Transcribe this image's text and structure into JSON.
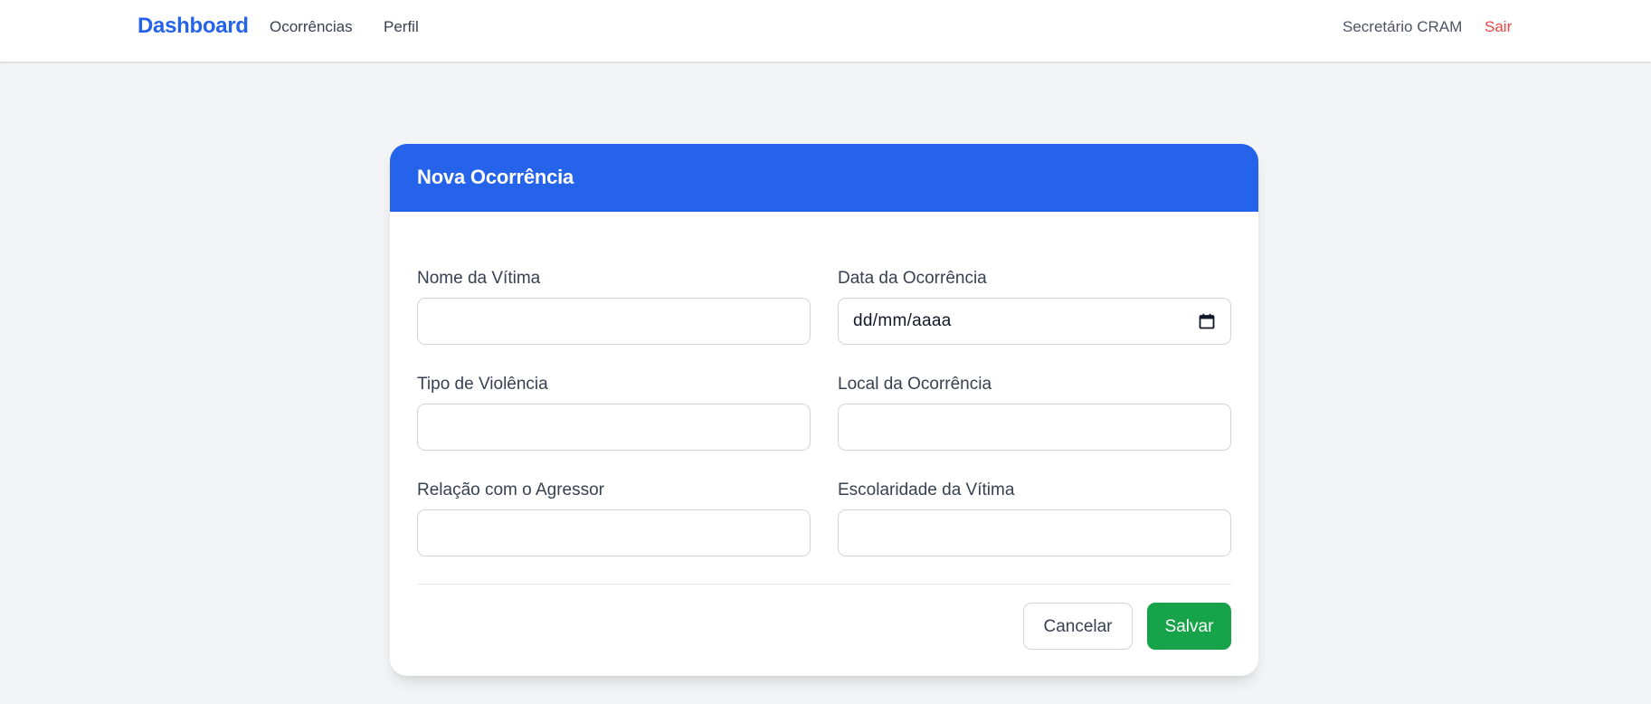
{
  "navbar": {
    "brand": "Dashboard",
    "links": [
      "Ocorrências",
      "Perfil"
    ],
    "user_name": "Secretário CRAM",
    "logout_label": "Sair"
  },
  "form": {
    "title": "Nova Ocorrência",
    "fields": {
      "nome_vitima": {
        "label": "Nome da Vítima",
        "value": ""
      },
      "data_ocorrencia": {
        "label": "Data da Ocorrência",
        "placeholder": "dd/mm/aaaa",
        "value": ""
      },
      "tipo_violencia": {
        "label": "Tipo de Violência",
        "value": ""
      },
      "local_ocorrencia": {
        "label": "Local da Ocorrência",
        "value": ""
      },
      "relacao_agressor": {
        "label": "Relação com o Agressor",
        "value": ""
      },
      "escolaridade_vitima": {
        "label": "Escolaridade da Vítima",
        "value": ""
      }
    },
    "actions": {
      "cancel_label": "Cancelar",
      "save_label": "Salvar"
    }
  },
  "icons": {
    "date_picker": "calendar-icon"
  },
  "colors": {
    "brand_blue": "#2563eb",
    "save_green": "#16a34a",
    "logout_red": "#ef4444",
    "background": "#f3f4f6"
  }
}
